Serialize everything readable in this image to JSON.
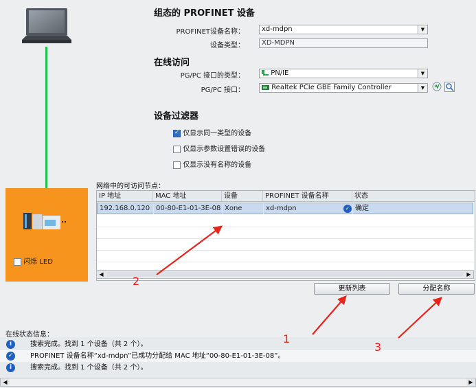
{
  "config_section": {
    "title": "组态的 PROFINET 设备",
    "device_name_label": "PROFINET设备名称：",
    "device_name_value": "xd-mdpn",
    "device_type_label": "设备类型：",
    "device_type_value": "XD-MDPN"
  },
  "online_section": {
    "title": "在线访问",
    "pgpc_type_label": "PG/PC 接口的类型：",
    "pgpc_type_value": "PN/IE",
    "pgpc_if_label": "PG/PC 接口：",
    "pgpc_if_value": "Realtek PCIe GBE Family Controller"
  },
  "filter_section": {
    "title": "设备过滤器",
    "options": [
      {
        "label": "仅显示同一类型的设备",
        "checked": true
      },
      {
        "label": "仅显示参数设置错误的设备",
        "checked": false
      },
      {
        "label": "仅显示没有名称的设备",
        "checked": false
      }
    ]
  },
  "device_panel": {
    "led_label": "闪烁 LED"
  },
  "nodes_table": {
    "caption": "网络中的可访问节点：",
    "columns": [
      "IP 地址",
      "MAC 地址",
      "设备",
      "PROFINET 设备名称",
      "状态"
    ],
    "rows": [
      {
        "ip": "192.168.0.120",
        "mac": "00-80-E1-01-3E-08",
        "device": "Xone",
        "name": "xd-mdpn",
        "status": "确定"
      }
    ]
  },
  "buttons": {
    "update_list": "更新列表",
    "assign_name": "分配名称"
  },
  "status_section": {
    "title": "在线状态信息：",
    "messages": [
      {
        "icon": "info",
        "text": "搜索完成。找到 1 个设备（共 2 个）。"
      },
      {
        "icon": "check",
        "text": "PROFINET 设备名称“xd-mdpn”已成功分配给 MAC 地址“00-80-E1-01-3E-08”。"
      },
      {
        "icon": "info",
        "text": "搜索完成。找到 1 个设备（共 2 个）。"
      }
    ]
  },
  "annotations": {
    "n1": "1",
    "n2": "2",
    "n3": "3"
  },
  "colors": {
    "link_line": "#22c14a",
    "device_panel": "#f7941d",
    "annotation": "#e8241c",
    "selection": "#c9d9ee"
  }
}
